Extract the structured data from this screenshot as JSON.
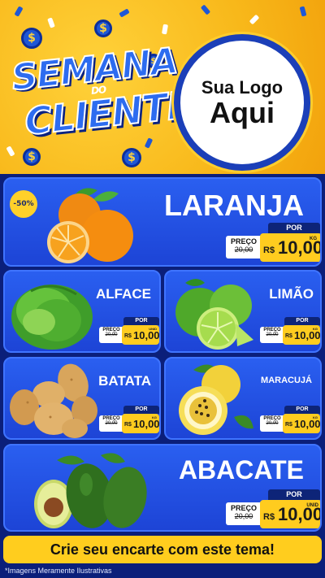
{
  "header": {
    "title_line1": "SEMANA",
    "title_small": "DO",
    "title_line2": "CLIENTE",
    "logo_line1": "Sua Logo",
    "logo_line2": "Aqui",
    "coin_symbol": "$"
  },
  "products": {
    "laranja": {
      "name": "LARANJA",
      "badge": "-50%",
      "por": "POR",
      "preco_label": "PREÇO",
      "old_price": "20,00",
      "currency": "R$",
      "price": "10,00",
      "unit": "KG"
    },
    "alface": {
      "name": "ALFACE",
      "por": "POR",
      "preco_label": "PREÇO",
      "old_price": "20,00",
      "currency": "R$",
      "price": "10,00",
      "unit": "UNID"
    },
    "limao": {
      "name": "LIMÃO",
      "por": "POR",
      "preco_label": "PREÇO",
      "old_price": "20,00",
      "currency": "R$",
      "price": "10,00",
      "unit": "KG"
    },
    "batata": {
      "name": "BATATA",
      "por": "POR",
      "preco_label": "PREÇO",
      "old_price": "20,00",
      "currency": "R$",
      "price": "10,00",
      "unit": "KG"
    },
    "maracuja": {
      "name": "MARACUJÁ",
      "por": "POR",
      "preco_label": "PREÇO",
      "old_price": "20,00",
      "currency": "R$",
      "price": "10,00",
      "unit": "KG"
    },
    "abacate": {
      "name": "ABACATE",
      "por": "POR",
      "preco_label": "PREÇO",
      "old_price": "20,00",
      "currency": "R$",
      "price": "10,00",
      "unit": "UNID"
    }
  },
  "footer": {
    "cta": "Crie seu encarte com este tema!",
    "disclaimer": "*Imagens Meramente Ilustrativas"
  },
  "colors": {
    "background": "#0b1f7a",
    "header_yellow": "#f8b81a",
    "card_blue": "#2a5ff0",
    "price_yellow": "#ffcc1f"
  }
}
